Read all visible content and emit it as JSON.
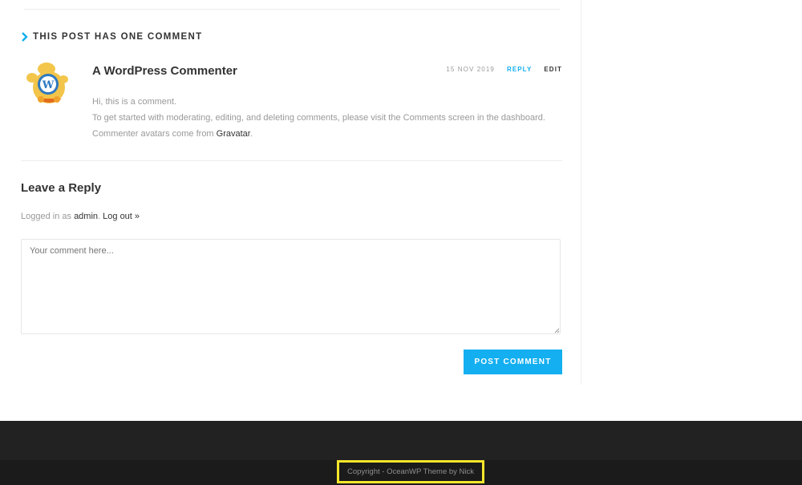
{
  "comments": {
    "title": "THIS POST HAS ONE COMMENT",
    "items": [
      {
        "author": "A WordPress Commenter",
        "date": "15 NOV 2019",
        "reply_label": "REPLY",
        "edit_label": "EDIT",
        "lines": [
          "Hi, this is a comment.",
          "To get started with moderating, editing, and deleting comments, please visit the Comments screen in the dashboard."
        ],
        "line3_prefix": "Commenter avatars come from ",
        "line3_link": "Gravatar",
        "line3_suffix": "."
      }
    ]
  },
  "reply_form": {
    "title": "Leave a Reply",
    "logged_prefix": "Logged in as ",
    "user": "admin",
    "sep": ". ",
    "logout_label": "Log out »",
    "placeholder": "Your comment here...",
    "submit_label": "POST COMMENT"
  },
  "footer": {
    "copyright": "Copyright - OceanWP Theme by Nick"
  },
  "colors": {
    "accent": "#13aff0",
    "highlight": "#f7e62a",
    "footer_bg": "#222222"
  },
  "icons": {
    "title": "chevron-right-icon",
    "avatar": "wapuu-avatar",
    "grip": "resize-grip-icon"
  }
}
